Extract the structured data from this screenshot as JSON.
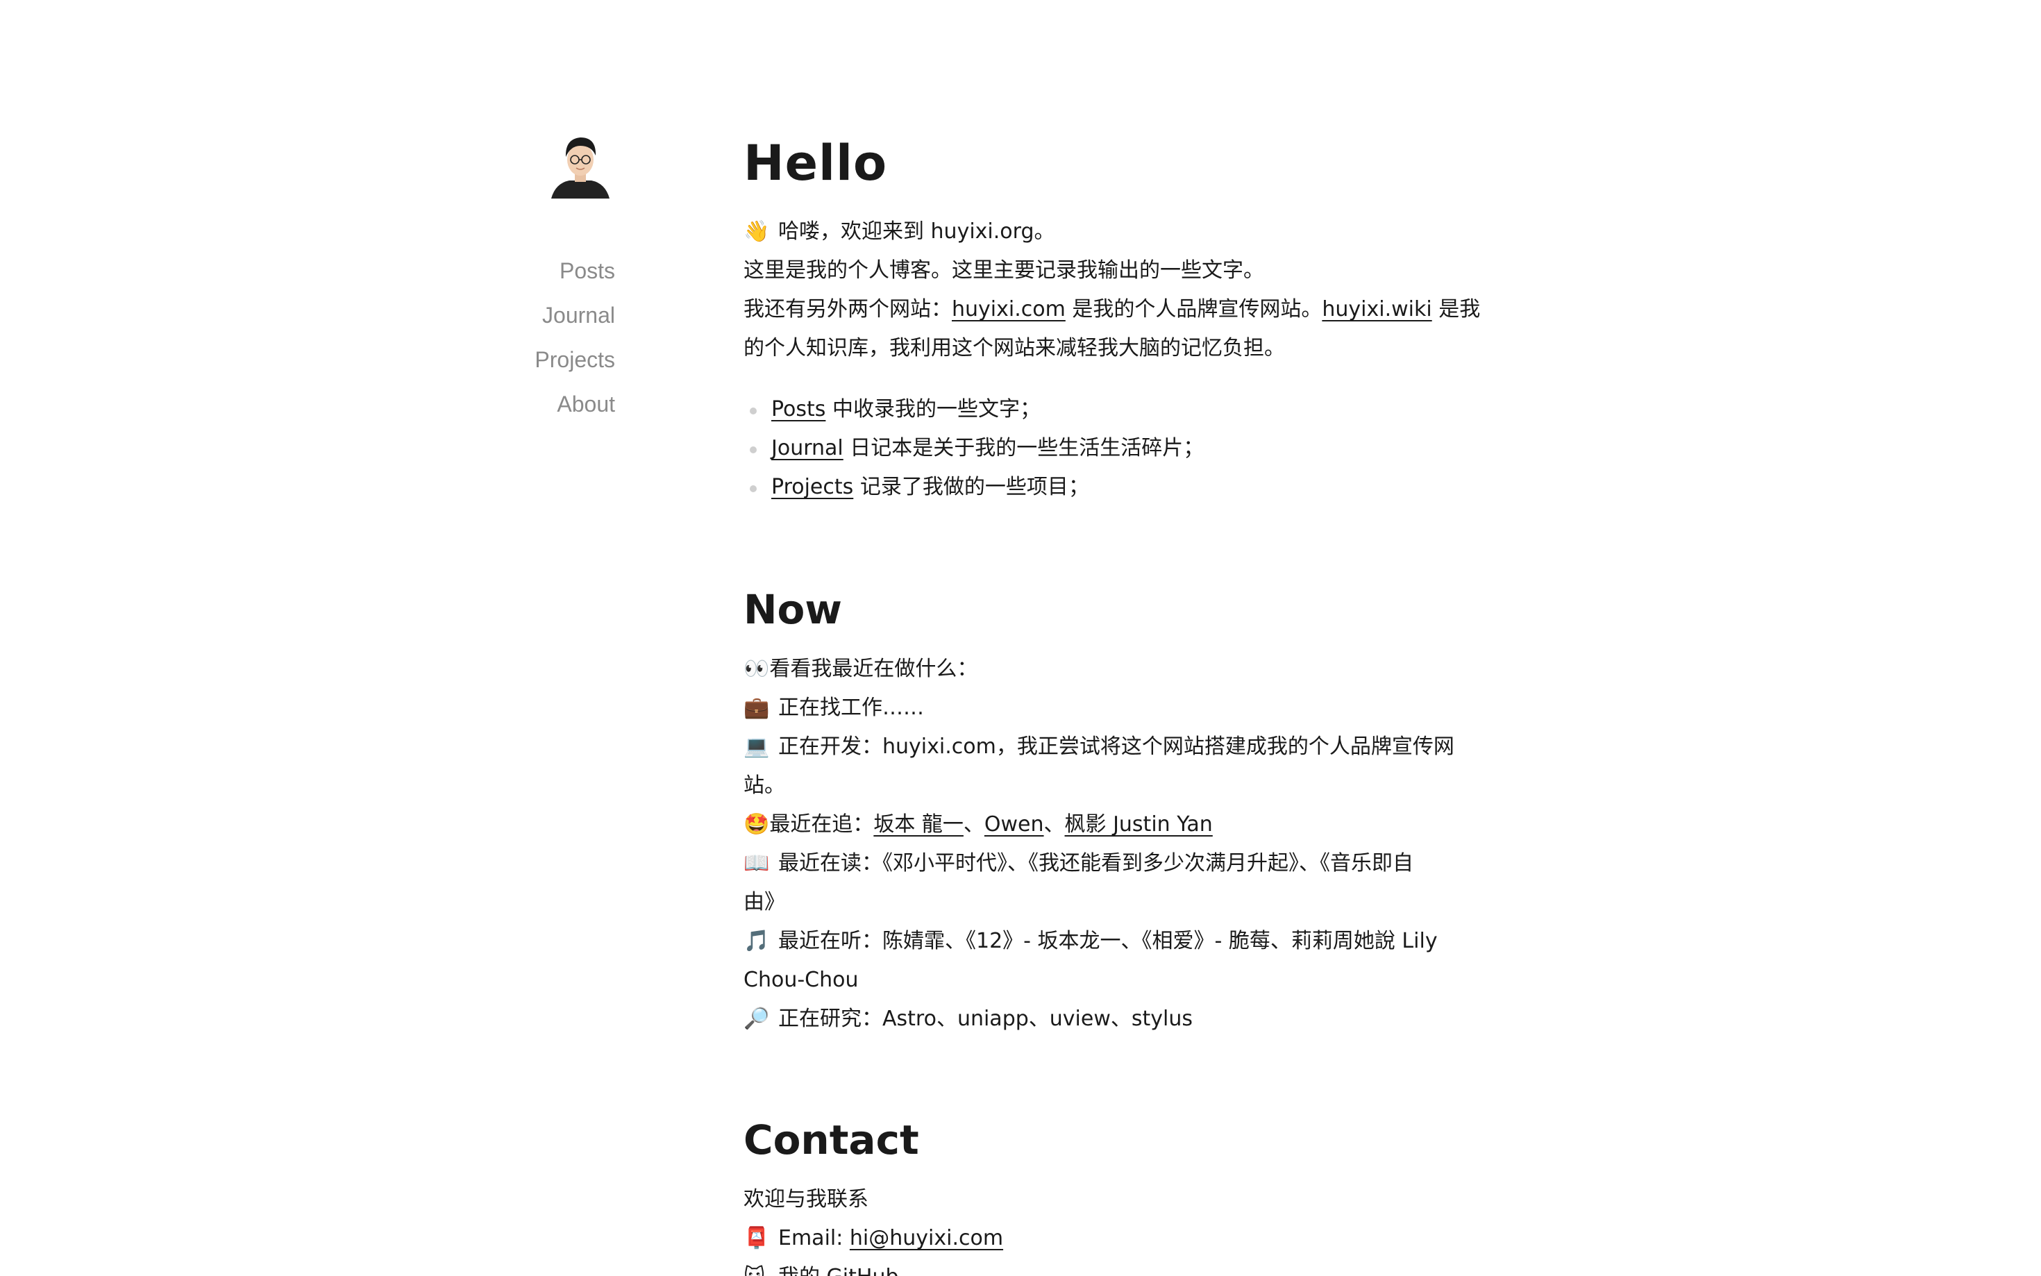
{
  "nav": {
    "items": [
      {
        "label": "Posts"
      },
      {
        "label": "Journal"
      },
      {
        "label": "Projects"
      },
      {
        "label": "About"
      }
    ]
  },
  "hello": {
    "title": "Hello",
    "line1_emoji": "👋",
    "line1": "哈喽，欢迎来到 huyixi.org。",
    "line2": "这里是我的个人博客。这里主要记录我输出的一些文字。",
    "line3_pre": "我还有另外两个网站：",
    "line3_link1": "huyixi.com",
    "line3_mid": " 是我的个人品牌宣传网站。",
    "line3_link2": "huyixi.wiki",
    "line3_post": " 是我",
    "line4": "的个人知识库，我利用这个网站来减轻我大脑的记忆负担。",
    "bullets": [
      {
        "link": "Posts",
        "text": " 中收录我的一些文字；"
      },
      {
        "link": "Journal",
        "text": " 日记本是关于我的一些生活生活碎片；"
      },
      {
        "link": "Projects",
        "text": " 记录了我做的一些项目；"
      }
    ]
  },
  "now": {
    "title": "Now",
    "intro_emoji": "👀",
    "intro": "看看我最近在做什么：",
    "job_emoji": "💼",
    "job": "正在找工作……",
    "dev_emoji": "💻",
    "dev": "正在开发：huyixi.com，我正尝试将这个网站搭建成我的个人品牌宣传网",
    "dev_cont": "站。",
    "follow_emoji": "🤩",
    "follow_pre": "最近在追：",
    "follow_link1": "坂本 龍一",
    "follow_sep1": "、",
    "follow_link2": "Owen",
    "follow_sep2": "、",
    "follow_link3": "枫影 Justin Yan",
    "read_emoji": "📖",
    "read": "最近在读：《邓小平时代》、《我还能看到多少次满月升起》、《音乐即自",
    "read_cont": "由》",
    "listen_emoji": "🎵",
    "listen": "最近在听：陈婧霏、《12》- 坂本龙一、《相爱》- 脆莓、莉莉周她說 Lily",
    "listen_cont": "Chou-Chou",
    "research_emoji": "🔎",
    "research": "正在研究：Astro、uniapp、uview、stylus"
  },
  "contact": {
    "title": "Contact",
    "intro": "欢迎与我联系",
    "email_emoji": "📮",
    "email_label": "Email: ",
    "email_link": "hi@huyixi.com",
    "github_emoji": "🐱",
    "github_label": "我的 GitHub"
  }
}
